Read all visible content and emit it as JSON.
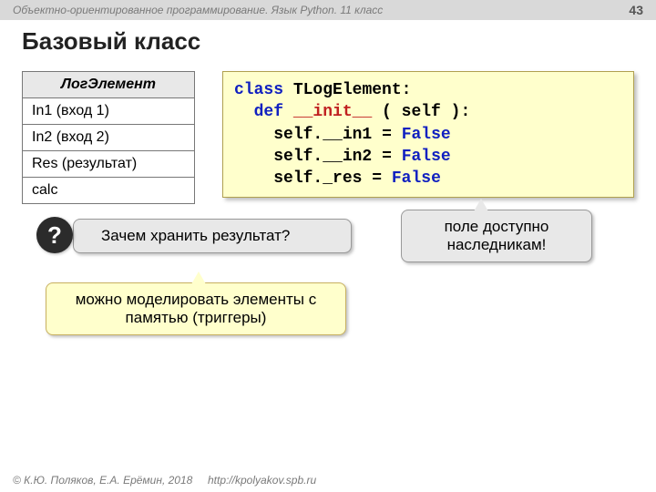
{
  "header": {
    "course": "Объектно-ориентированное программирование. Язык Python. 11 класс",
    "page": "43"
  },
  "title": "Базовый класс",
  "table": {
    "header": "ЛогЭлемент",
    "rows": [
      "In1 (вход 1)",
      "In2 (вход 2)",
      "Res (результат)",
      "calc"
    ]
  },
  "code": {
    "kw_class": "class",
    "classname": "TLogElement",
    "kw_def": "def",
    "fn_init": "__init__",
    "self": "self",
    "line1a": "self.__in1",
    "line2a": "self.__in2",
    "line3a": "self._res",
    "eq": "=",
    "kw_false": "False"
  },
  "q": {
    "mark": "?",
    "text": "Зачем хранить результат?"
  },
  "note_right": "поле доступно наследникам!",
  "note_bottom": "можно моделировать элементы с памятью (триггеры)",
  "footer": {
    "copyright": "© К.Ю. Поляков, Е.А. Ерёмин, 2018",
    "url": "http://kpolyakov.spb.ru"
  }
}
